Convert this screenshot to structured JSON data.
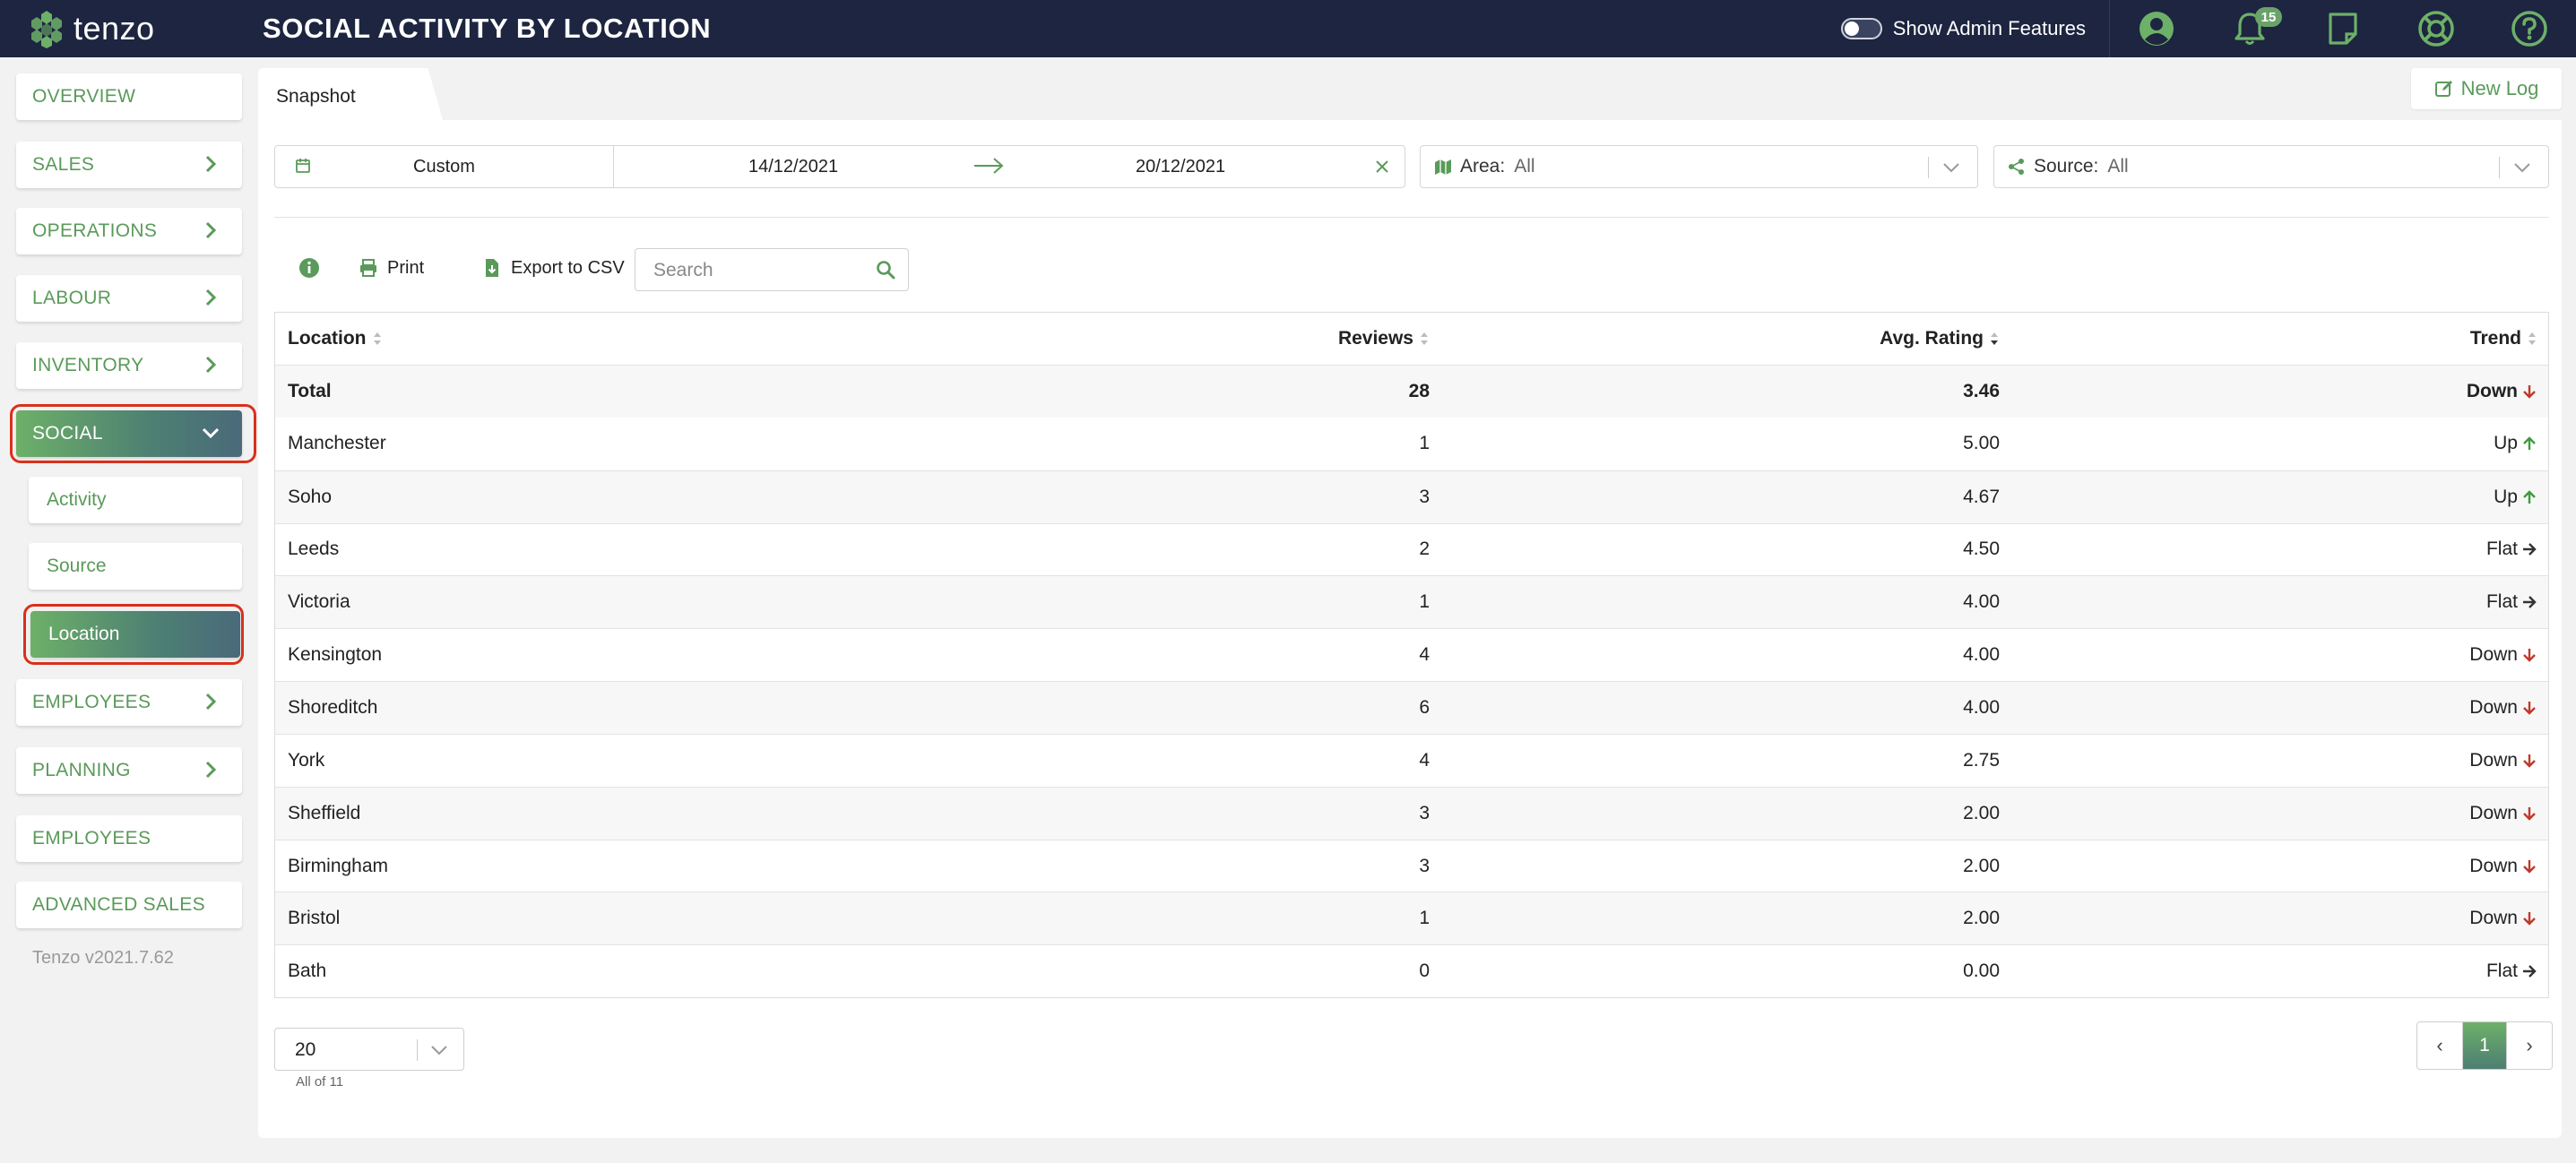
{
  "app": {
    "logo_text": "tenzo",
    "page_title": "SOCIAL ACTIVITY BY LOCATION"
  },
  "topbar": {
    "admin_toggle_label": "Show Admin Features",
    "admin_toggle_on": false,
    "notification_count": "15",
    "icons": [
      "user-icon",
      "bell-icon",
      "note-icon",
      "support-icon",
      "help-icon"
    ]
  },
  "sidebar": {
    "items": [
      {
        "label": "OVERVIEW",
        "chevron": false
      },
      {
        "label": "SALES",
        "chevron": true
      },
      {
        "label": "OPERATIONS",
        "chevron": true
      },
      {
        "label": "LABOUR",
        "chevron": true
      },
      {
        "label": "INVENTORY",
        "chevron": true
      },
      {
        "label": "SOCIAL",
        "chevron": "down",
        "active": true
      },
      {
        "label": "EMPLOYEES",
        "chevron": true
      },
      {
        "label": "PLANNING",
        "chevron": true
      },
      {
        "label": "EMPLOYEES",
        "chevron": false
      },
      {
        "label": "ADVANCED SALES",
        "chevron": false
      }
    ],
    "social_sub": [
      {
        "label": "Activity"
      },
      {
        "label": "Source"
      },
      {
        "label": "Location",
        "active": true
      }
    ],
    "version": "Tenzo v2021.7.62"
  },
  "tabs": {
    "snapshot": "Snapshot"
  },
  "new_log_label": "New Log",
  "filters": {
    "range_type": "Custom",
    "date_from": "14/12/2021",
    "date_to": "20/12/2021",
    "area_label": "Area:",
    "area_value": "All",
    "source_label": "Source:",
    "source_value": "All"
  },
  "toolbar": {
    "print_label": "Print",
    "export_label": "Export to CSV",
    "search_placeholder": "Search"
  },
  "table": {
    "columns": [
      "Location",
      "Reviews",
      "Avg. Rating",
      "Trend"
    ],
    "total": {
      "location": "Total",
      "reviews": "28",
      "avg": "3.46",
      "trend": "Down"
    },
    "rows": [
      {
        "location": "Manchester",
        "reviews": "1",
        "avg": "5.00",
        "trend": "Up"
      },
      {
        "location": "Soho",
        "reviews": "3",
        "avg": "4.67",
        "trend": "Up"
      },
      {
        "location": "Leeds",
        "reviews": "2",
        "avg": "4.50",
        "trend": "Flat"
      },
      {
        "location": "Victoria",
        "reviews": "1",
        "avg": "4.00",
        "trend": "Flat"
      },
      {
        "location": "Kensington",
        "reviews": "4",
        "avg": "4.00",
        "trend": "Down"
      },
      {
        "location": "Shoreditch",
        "reviews": "6",
        "avg": "4.00",
        "trend": "Down"
      },
      {
        "location": "York",
        "reviews": "4",
        "avg": "2.75",
        "trend": "Down"
      },
      {
        "location": "Sheffield",
        "reviews": "3",
        "avg": "2.00",
        "trend": "Down"
      },
      {
        "location": "Birmingham",
        "reviews": "3",
        "avg": "2.00",
        "trend": "Down"
      },
      {
        "location": "Bristol",
        "reviews": "1",
        "avg": "2.00",
        "trend": "Down"
      },
      {
        "location": "Bath",
        "reviews": "0",
        "avg": "0.00",
        "trend": "Flat"
      }
    ]
  },
  "pagination": {
    "page_size": "20",
    "count_text": "All of 11",
    "prev": "‹",
    "current": "1",
    "next": "›"
  },
  "colors": {
    "topbar": "#1d2540",
    "accent_green": "#5a9a5a",
    "trend_up": "#3f9a3f",
    "trend_down": "#c0392b",
    "trend_flat": "#333333",
    "highlight_ring": "#d9301c"
  }
}
